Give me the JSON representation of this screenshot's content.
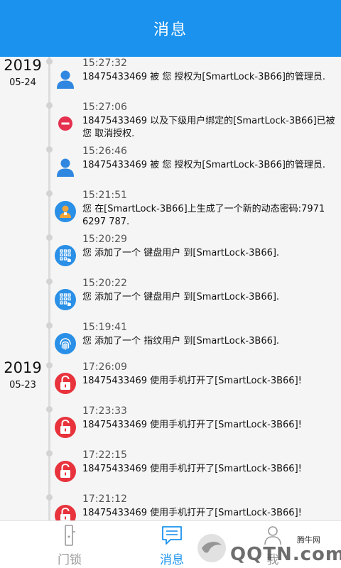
{
  "header": {
    "title": "消息"
  },
  "groups": [
    {
      "year": "2019",
      "date": "05-24"
    },
    {
      "year": "2019",
      "date": "05-23"
    }
  ],
  "messages": [
    {
      "time": "15:27:32",
      "text": "18475433469 被 您 授权为[SmartLock-3B66]的管理员.",
      "icon": "user-icon"
    },
    {
      "time": "15:27:06",
      "text": "18475433469 以及下级用户绑定的[SmartLock-3B66]已被 您 取消授权.",
      "icon": "minus-circle-icon"
    },
    {
      "time": "15:26:46",
      "text": "18475433469 被 您 授权为[SmartLock-3B66]的管理员.",
      "icon": "user-icon"
    },
    {
      "time": "15:21:51",
      "text": "您 在[SmartLock-3B66]上生成了一个新的动态密码:7971 6297 787.",
      "icon": "temp-password-icon"
    },
    {
      "time": "15:20:29",
      "text": "您 添加了一个 键盘用户 到[SmartLock-3B66].",
      "icon": "keypad-icon"
    },
    {
      "time": "15:20:22",
      "text": "您 添加了一个 键盘用户 到[SmartLock-3B66].",
      "icon": "keypad-icon"
    },
    {
      "time": "15:19:41",
      "text": "您 添加了一个 指纹用户 到[SmartLock-3B66].",
      "icon": "fingerprint-icon"
    },
    {
      "time": "17:26:09",
      "text": "18475433469 使用手机打开了[SmartLock-3B66]!",
      "icon": "unlock-icon"
    },
    {
      "time": "17:23:33",
      "text": "18475433469 使用手机打开了[SmartLock-3B66]!",
      "icon": "unlock-icon"
    },
    {
      "time": "17:22:15",
      "text": "18475433469 使用手机打开了[SmartLock-3B66]!",
      "icon": "unlock-icon"
    },
    {
      "time": "17:21:12",
      "text": "18475433469 使用手机打开了[SmartLock-3B66]!",
      "icon": "unlock-icon"
    }
  ],
  "tabs": [
    {
      "label": "门锁",
      "icon": "door-lock-icon",
      "active": false
    },
    {
      "label": "消息",
      "icon": "message-icon",
      "active": true
    },
    {
      "label": "我",
      "icon": "person-icon",
      "active": false
    }
  ],
  "watermark": {
    "sub": "腾牛网",
    "main": "QQTN.com"
  },
  "colors": {
    "accent": "#1a92ee",
    "unlock_red": "#e8333c",
    "remove_red": "#e5304f",
    "user_blue": "#2f87e0",
    "tab_inactive": "#9a9a9a",
    "background": "#f5f5f5"
  }
}
